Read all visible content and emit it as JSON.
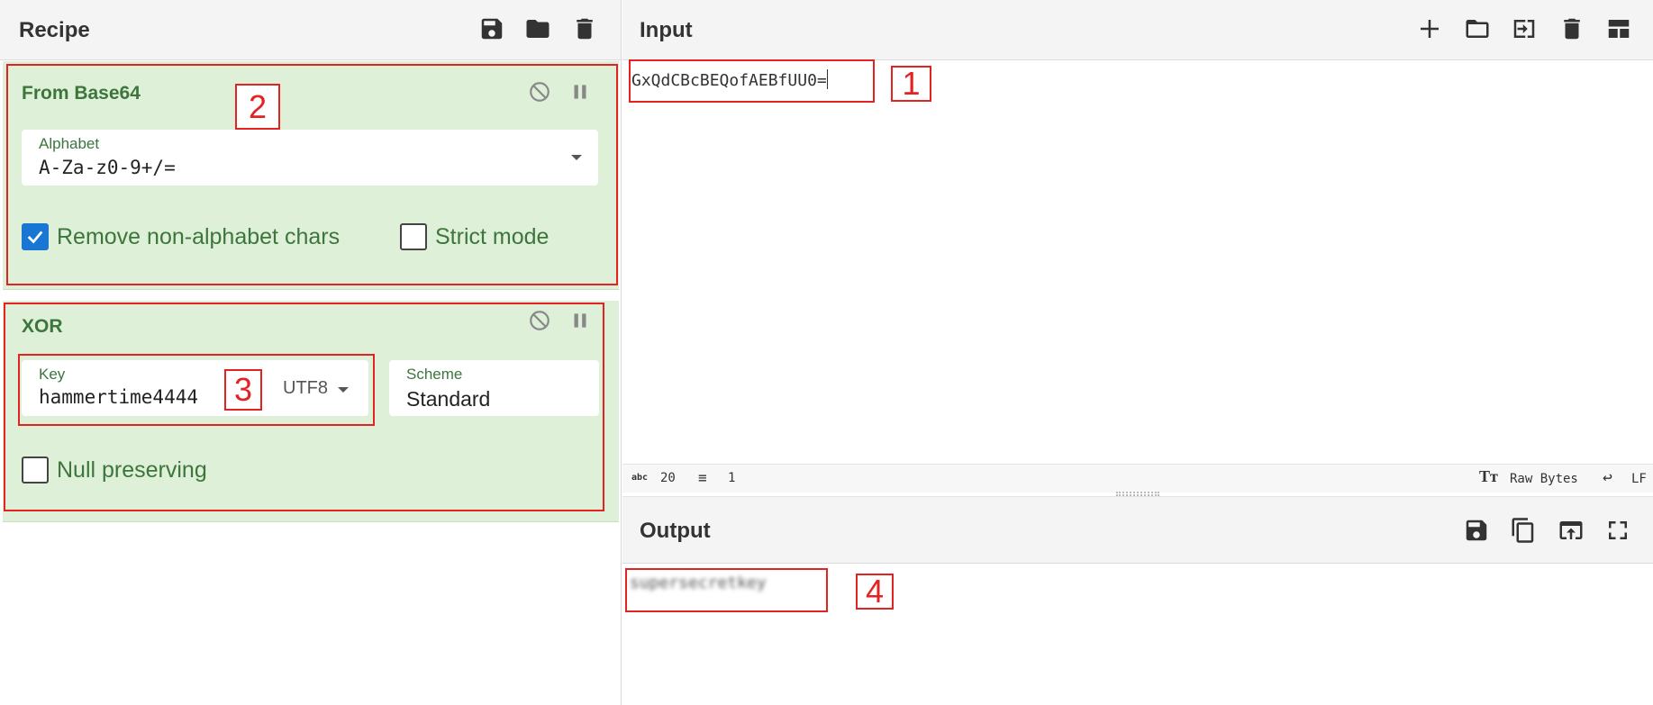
{
  "recipe": {
    "title": "Recipe",
    "operations": [
      {
        "name": "From Base64",
        "alphabet_label": "Alphabet",
        "alphabet_value": "A-Za-z0-9+/=",
        "remove_non_alphabet_label": "Remove non-alphabet chars",
        "remove_non_alphabet_checked": true,
        "strict_mode_label": "Strict mode",
        "strict_mode_checked": false
      },
      {
        "name": "XOR",
        "key_label": "Key",
        "key_value": "hammertime4444",
        "key_encoding": "UTF8",
        "scheme_label": "Scheme",
        "scheme_value": "Standard",
        "null_preserving_label": "Null preserving",
        "null_preserving_checked": false
      }
    ]
  },
  "input": {
    "title": "Input",
    "value": "GxQdCBcBEQofAEBfUU0=",
    "status": {
      "chars_icon": "abc-icon",
      "chars": "20",
      "lines": "1",
      "raw_bytes": "Raw Bytes",
      "eol": "LF"
    }
  },
  "output": {
    "title": "Output",
    "value": "supersecretkey"
  },
  "annotations": [
    "1",
    "2",
    "3",
    "4"
  ],
  "colors": {
    "op_bg": "#dff0d8",
    "op_text": "#3c763d",
    "annotation": "#e32222",
    "checkbox": "#1976d2"
  }
}
